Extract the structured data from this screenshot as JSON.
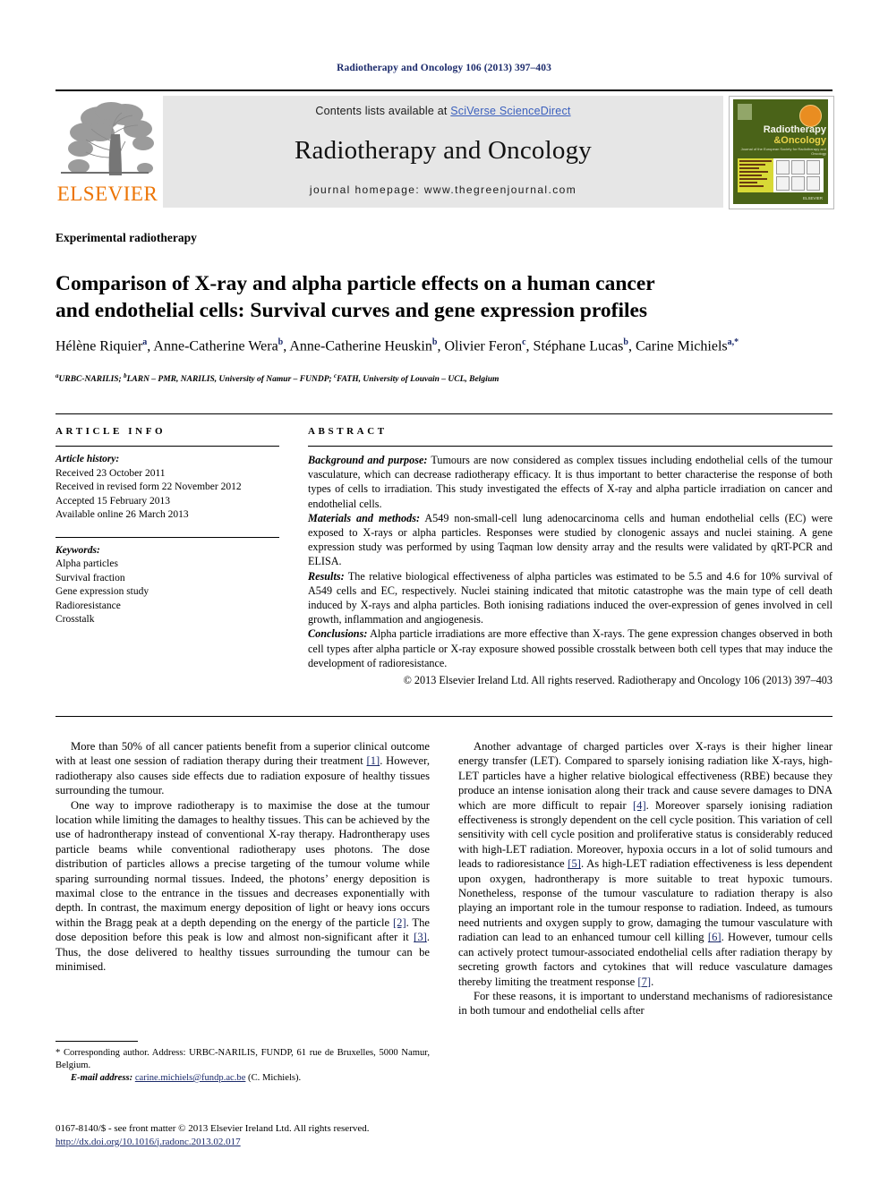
{
  "running_head": "Radiotherapy and Oncology 106 (2013) 397–403",
  "masthead": {
    "publisher_logo_name": "elsevier-tree-logo",
    "publisher_wordmark": "ELSEVIER",
    "contents_prefix": "Contents lists available at ",
    "contents_link": "SciVerse ScienceDirect",
    "journal_name": "Radiotherapy and Oncology",
    "homepage": "journal homepage: www.thegreenjournal.com",
    "link_color": "#3a5fbd",
    "band_bg": "#e6e6e6",
    "cover": {
      "title_line1": "Radiotherapy",
      "title_line2": "&Oncology",
      "subtitle": "Journal of the European Society for Radiotherapy and Oncology",
      "badge_name": "open-access-badge",
      "footer_mark": "ELSEVIER",
      "bg_color": "#4a6318",
      "accent_color": "#d8d936",
      "badge_color": "#e98d21"
    }
  },
  "article": {
    "kicker": "Experimental radiotherapy",
    "title_line1": "Comparison of X-ray and alpha particle effects on a human cancer",
    "title_line2": "and endothelial cells: Survival curves and gene expression profiles",
    "authors": [
      {
        "name": "Hélène Riquier",
        "marks": "a",
        "sep": ", "
      },
      {
        "name": "Anne-Catherine Wera",
        "marks": "b",
        "sep": ", "
      },
      {
        "name": "Anne-Catherine Heuskin",
        "marks": "b",
        "sep": ", "
      },
      {
        "name": "Olivier Feron",
        "marks": "c",
        "sep": ", "
      },
      {
        "name": "Stéphane Lucas",
        "marks": "b",
        "sep": ", "
      },
      {
        "name": "Carine Michiels",
        "marks": "a,*",
        "sep": ""
      }
    ],
    "affiliations": "URBC-NARILIS; LARN – PMR, NARILIS, University of Namur – FUNDP; FATH, University of Louvain – UCL, Belgium",
    "affiliation_parts": [
      {
        "mark": "a",
        "text": "URBC-NARILIS; "
      },
      {
        "mark": "b",
        "text": "LARN – PMR, NARILIS, University of Namur – FUNDP; "
      },
      {
        "mark": "c",
        "text": "FATH, University of Louvain – UCL, Belgium"
      }
    ]
  },
  "article_info": {
    "heading": "ARTICLE INFO",
    "history_label": "Article history:",
    "history": [
      "Received 23 October 2011",
      "Received in revised form 22 November 2012",
      "Accepted 15 February 2013",
      "Available online 26 March 2013"
    ],
    "keywords_label": "Keywords:",
    "keywords": [
      "Alpha particles",
      "Survival fraction",
      "Gene expression study",
      "Radioresistance",
      "Crosstalk"
    ]
  },
  "abstract": {
    "heading": "ABSTRACT",
    "sections": [
      {
        "label": "Background and purpose:",
        "text": " Tumours are now considered as complex tissues including endothelial cells of the tumour vasculature, which can decrease radiotherapy efficacy. It is thus important to better characterise the response of both types of cells to irradiation. This study investigated the effects of X-ray and alpha particle irradiation on cancer and endothelial cells."
      },
      {
        "label": "Materials and methods:",
        "text": " A549 non-small-cell lung adenocarcinoma cells and human endothelial cells (EC) were exposed to X-rays or alpha particles. Responses were studied by clonogenic assays and nuclei staining. A gene expression study was performed by using Taqman low density array and the results were validated by qRT-PCR and ELISA."
      },
      {
        "label": "Results:",
        "text": " The relative biological effectiveness of alpha particles was estimated to be 5.5 and 4.6 for 10% survival of A549 cells and EC, respectively. Nuclei staining indicated that mitotic catastrophe was the main type of cell death induced by X-rays and alpha particles. Both ionising radiations induced the over-expression of genes involved in cell growth, inflammation and angiogenesis."
      },
      {
        "label": "Conclusions:",
        "text": " Alpha particle irradiations are more effective than X-rays. The gene expression changes observed in both cell types after alpha particle or X-ray exposure showed possible crosstalk between both cell types that may induce the development of radioresistance."
      }
    ],
    "copyright": "© 2013 Elsevier Ireland Ltd. All rights reserved. Radiotherapy and Oncology 106 (2013) 397–403"
  },
  "body": {
    "left_column": [
      {
        "id": "para-1",
        "runs": [
          {
            "t": "More than 50% of all cancer patients benefit from a superior clinical outcome with at least one session of radiation therapy during their treatment "
          },
          {
            "t": "[1]",
            "ref": true
          },
          {
            "t": ". However, radiotherapy also causes side effects due to radiation exposure of healthy tissues surrounding the tumour."
          }
        ]
      },
      {
        "id": "para-2",
        "runs": [
          {
            "t": "One way to improve radiotherapy is to maximise the dose at the tumour location while limiting the damages to healthy tissues. This can be achieved by the use of hadrontherapy instead of conventional X-ray therapy. Hadrontherapy uses particle beams while conventional radiotherapy uses photons. The dose distribution of particles allows a precise targeting of the tumour volume while sparing surrounding normal tissues. Indeed, the photons’ energy deposition is maximal close to the entrance in the tissues and decreases exponentially with depth. In contrast, the maximum energy deposition of light or heavy ions occurs within the Bragg peak at a depth depending on the energy of the particle "
          },
          {
            "t": "[2]",
            "ref": true
          },
          {
            "t": ". The dose deposition before this peak is low and almost non-significant after it "
          },
          {
            "t": "[3]",
            "ref": true
          },
          {
            "t": ". Thus, the dose delivered to healthy tissues surrounding the tumour can be minimised."
          }
        ]
      }
    ],
    "right_column": [
      {
        "id": "para-3",
        "runs": [
          {
            "t": "Another advantage of charged particles over X-rays is their higher linear energy transfer (LET). Compared to sparsely ionising radiation like X-rays, high-LET particles have a higher relative biological effectiveness (RBE) because they produce an intense ionisation along their track and cause severe damages to DNA which are more difficult to repair "
          },
          {
            "t": "[4]",
            "ref": true
          },
          {
            "t": ". Moreover sparsely ionising radiation effectiveness is strongly dependent on the cell cycle position. This variation of cell sensitivity with cell cycle position and proliferative status is considerably reduced with high-LET radiation. Moreover, hypoxia occurs in a lot of solid tumours and leads to radioresistance "
          },
          {
            "t": "[5]",
            "ref": true
          },
          {
            "t": ". As high-LET radiation effectiveness is less dependent upon oxygen, hadrontherapy is more suitable to treat hypoxic tumours. Nonetheless, response of the tumour vasculature to radiation therapy is also playing an important role in the tumour response to radiation. Indeed, as tumours need nutrients and oxygen supply to grow, damaging the tumour vasculature with radiation can lead to an enhanced tumour cell killing "
          },
          {
            "t": "[6]",
            "ref": true
          },
          {
            "t": ". However, tumour cells can actively protect tumour-associated endothelial cells after radiation therapy by secreting growth factors and cytokines that will reduce vasculature damages thereby limiting the treatment response "
          },
          {
            "t": "[7]",
            "ref": true
          },
          {
            "t": "."
          }
        ]
      },
      {
        "id": "para-4",
        "runs": [
          {
            "t": "For these reasons, it is important to understand mechanisms of radioresistance in both tumour and endothelial cells after"
          }
        ]
      }
    ]
  },
  "footnotes": {
    "corresponding": "* Corresponding author. Address: URBC-NARILIS, FUNDP, 61 rue de Bruxelles, 5000 Namur, Belgium.",
    "email_label": "E-mail address:",
    "email": "carine.michiels@fundp.ac.be",
    "email_suffix": " (C. Michiels)."
  },
  "footer": {
    "issn_line": "0167-8140/$ - see front matter © 2013 Elsevier Ireland Ltd. All rights reserved.",
    "doi": "http://dx.doi.org/10.1016/j.radonc.2013.02.017"
  }
}
